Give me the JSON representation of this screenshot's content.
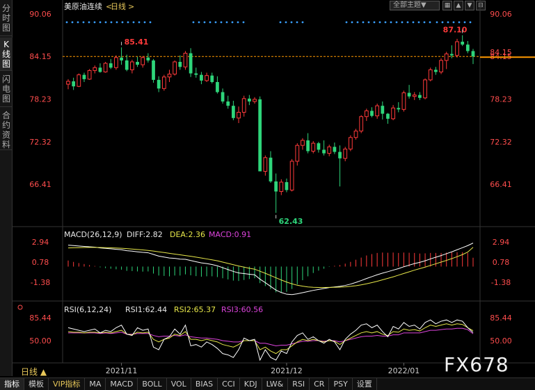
{
  "title": {
    "name": "美原油连续",
    "period": "日线",
    "left_bracket": "<",
    "right_bracket": ">"
  },
  "left_tabs": [
    "分时图",
    "K线图",
    "闪电图",
    "合约资料"
  ],
  "toolbar": {
    "theme": "全部主题▼",
    "btn1": "▦",
    "btn2": "▲",
    "btn3": "▼",
    "btn4": "⊟"
  },
  "price_panel": {
    "y_ticks": [
      "90.06",
      "84.15",
      "78.23",
      "72.32",
      "66.41"
    ],
    "current_price_label": "84.15",
    "marks": {
      "high1": "85.41",
      "low": "62.43",
      "high2": "87.10"
    }
  },
  "macd_panel": {
    "label": "MACD(26,12,9)",
    "diff": "DIFF:2.82",
    "dea": "DEA:2.36",
    "macd": "MACD:0.91",
    "y_ticks": [
      "2.94",
      "0.78",
      "-1.38"
    ]
  },
  "rsi_panel": {
    "label": "RSI(6,12,24)",
    "rsi1": "RSI1:62.44",
    "rsi2": "RSI2:65.37",
    "rsi3": "RSI3:60.56",
    "y_ticks": [
      "85.44",
      "50.00"
    ]
  },
  "x_axis": [
    "2021/11",
    "2021/12",
    "2022/01"
  ],
  "period_selector": "日线 ▲",
  "bottom_tabs": [
    "指标",
    "模板",
    "VIP指标",
    "MA",
    "MACD",
    "BOLL",
    "VOL",
    "BIAS",
    "CCI",
    "KDJ",
    "LW&",
    "RSI",
    "CR",
    "PSY",
    "设置"
  ],
  "brand": "FX678",
  "colors": {
    "up": "#ff3a3a",
    "down": "#2ed57a",
    "diff": "#ffffff",
    "dea": "#e8e84a",
    "rsi1": "#ffffff",
    "rsi2": "#e8e84a",
    "rsi3": "#dd44dd",
    "axis_text": "#ff4d4d",
    "accent": "#e8c85a"
  },
  "chart_data": {
    "type": "candlestick",
    "ylim": [
      62.43,
      90.06
    ],
    "candles": [
      [
        80.3,
        81.0,
        79.6,
        80.7
      ],
      [
        80.7,
        81.2,
        79.5,
        80.0
      ],
      [
        80.0,
        81.8,
        79.9,
        81.6
      ],
      [
        81.6,
        81.9,
        80.6,
        81.0
      ],
      [
        81.0,
        82.4,
        80.9,
        82.2
      ],
      [
        82.2,
        82.9,
        81.8,
        82.6
      ],
      [
        82.6,
        83.2,
        81.9,
        82.0
      ],
      [
        82.0,
        83.4,
        81.9,
        83.2
      ],
      [
        83.2,
        83.8,
        82.4,
        82.6
      ],
      [
        82.6,
        84.3,
        82.3,
        84.0
      ],
      [
        84.0,
        85.41,
        83.0,
        83.6
      ],
      [
        83.6,
        84.4,
        82.1,
        82.3
      ],
      [
        82.3,
        83.7,
        81.8,
        83.4
      ],
      [
        83.4,
        84.1,
        82.7,
        83.0
      ],
      [
        83.0,
        84.2,
        82.6,
        84.0
      ],
      [
        84.0,
        84.6,
        83.3,
        83.6
      ],
      [
        83.6,
        83.8,
        80.5,
        80.9
      ],
      [
        80.9,
        81.4,
        79.2,
        79.7
      ],
      [
        79.7,
        81.6,
        79.4,
        81.3
      ],
      [
        81.3,
        82.3,
        80.6,
        81.7
      ],
      [
        81.7,
        83.6,
        81.5,
        83.4
      ],
      [
        83.4,
        84.3,
        82.3,
        82.7
      ],
      [
        82.7,
        84.9,
        82.3,
        84.6
      ],
      [
        84.6,
        85.3,
        81.3,
        81.8
      ],
      [
        81.8,
        82.6,
        81.2,
        81.6
      ],
      [
        81.6,
        82.0,
        80.3,
        80.8
      ],
      [
        80.8,
        81.9,
        80.6,
        81.5
      ],
      [
        81.5,
        81.9,
        80.4,
        80.6
      ],
      [
        80.6,
        81.4,
        79.0,
        79.2
      ],
      [
        79.2,
        79.7,
        77.6,
        77.9
      ],
      [
        77.9,
        78.7,
        76.9,
        77.3
      ],
      [
        77.3,
        78.0,
        75.3,
        75.6
      ],
      [
        75.6,
        77.2,
        74.9,
        76.4
      ],
      [
        76.4,
        78.7,
        75.8,
        78.3
      ],
      [
        78.3,
        78.8,
        77.4,
        77.9
      ],
      [
        77.9,
        78.5,
        77.6,
        78.2
      ],
      [
        78.2,
        78.6,
        69.0,
        68.2
      ],
      [
        68.2,
        70.4,
        67.6,
        70.1
      ],
      [
        70.1,
        71.0,
        66.6,
        66.8
      ],
      [
        66.8,
        67.9,
        62.43,
        65.4
      ],
      [
        65.4,
        67.1,
        64.9,
        66.7
      ],
      [
        66.7,
        67.2,
        65.3,
        65.6
      ],
      [
        65.6,
        69.9,
        65.4,
        69.6
      ],
      [
        69.6,
        72.1,
        69.0,
        71.8
      ],
      [
        71.8,
        72.8,
        71.2,
        72.5
      ],
      [
        72.5,
        73.5,
        70.7,
        71.0
      ],
      [
        71.0,
        72.4,
        70.7,
        72.1
      ],
      [
        72.1,
        72.3,
        70.8,
        71.2
      ],
      [
        71.2,
        72.5,
        70.4,
        70.7
      ],
      [
        70.7,
        71.9,
        70.3,
        71.6
      ],
      [
        71.6,
        72.2,
        70.6,
        70.9
      ],
      [
        70.9,
        71.8,
        66.1,
        70.0
      ],
      [
        70.0,
        71.6,
        69.6,
        71.3
      ],
      [
        71.3,
        73.2,
        71.0,
        72.9
      ],
      [
        72.9,
        74.1,
        72.6,
        73.8
      ],
      [
        73.8,
        76.0,
        73.5,
        75.8
      ],
      [
        75.8,
        76.9,
        75.2,
        76.6
      ],
      [
        76.6,
        77.1,
        75.7,
        75.9
      ],
      [
        75.9,
        77.6,
        75.5,
        77.3
      ],
      [
        77.3,
        77.9,
        75.4,
        76.2
      ],
      [
        76.2,
        76.3,
        74.8,
        75.5
      ],
      [
        75.5,
        77.4,
        75.3,
        77.0
      ],
      [
        77.0,
        77.8,
        76.4,
        76.8
      ],
      [
        76.8,
        79.4,
        76.5,
        79.1
      ],
      [
        79.1,
        80.2,
        78.3,
        78.6
      ],
      [
        78.6,
        79.2,
        78.1,
        78.8
      ],
      [
        78.8,
        79.2,
        78.1,
        78.4
      ],
      [
        78.4,
        81.1,
        78.2,
        80.9
      ],
      [
        80.9,
        82.6,
        80.7,
        82.3
      ],
      [
        82.3,
        82.7,
        81.6,
        82.0
      ],
      [
        82.0,
        83.9,
        81.7,
        83.6
      ],
      [
        83.6,
        84.8,
        82.4,
        84.5
      ],
      [
        84.5,
        85.7,
        83.9,
        84.3
      ],
      [
        84.3,
        86.6,
        84.0,
        86.2
      ],
      [
        86.2,
        87.1,
        85.6,
        85.8
      ],
      [
        85.8,
        86.3,
        84.6,
        84.9
      ],
      [
        84.9,
        85.2,
        83.1,
        84.15
      ]
    ],
    "dates": {
      "2021/11": 10,
      "2021/12": 41,
      "2022/01": 63
    },
    "macd": {
      "ylim": [
        -3.3,
        3.6
      ],
      "diff": [
        2.6,
        2.55,
        2.5,
        2.46,
        2.42,
        2.38,
        2.3,
        2.25,
        2.2,
        2.15,
        2.1,
        2.0,
        1.95,
        1.88,
        1.82,
        1.78,
        1.6,
        1.42,
        1.32,
        1.22,
        1.18,
        1.1,
        1.08,
        0.95,
        0.82,
        0.7,
        0.62,
        0.52,
        0.38,
        0.18,
        -0.02,
        -0.22,
        -0.38,
        -0.45,
        -0.52,
        -0.58,
        -1.05,
        -1.42,
        -1.82,
        -2.22,
        -2.48,
        -2.66,
        -2.7,
        -2.62,
        -2.5,
        -2.38,
        -2.25,
        -2.15,
        -2.05,
        -1.95,
        -1.88,
        -1.82,
        -1.72,
        -1.58,
        -1.4,
        -1.2,
        -0.98,
        -0.78,
        -0.58,
        -0.4,
        -0.25,
        -0.08,
        0.08,
        0.28,
        0.45,
        0.62,
        0.75,
        0.92,
        1.12,
        1.3,
        1.48,
        1.68,
        1.88,
        2.1,
        2.32,
        2.55,
        2.82
      ],
      "dea": [
        2.3,
        2.32,
        2.33,
        2.34,
        2.35,
        2.35,
        2.34,
        2.33,
        2.31,
        2.29,
        2.26,
        2.22,
        2.18,
        2.13,
        2.08,
        2.03,
        1.96,
        1.88,
        1.8,
        1.72,
        1.64,
        1.56,
        1.48,
        1.4,
        1.31,
        1.22,
        1.12,
        1.02,
        0.92,
        0.78,
        0.64,
        0.5,
        0.36,
        0.24,
        0.12,
        0.02,
        -0.2,
        -0.42,
        -0.66,
        -0.9,
        -1.14,
        -1.36,
        -1.55,
        -1.7,
        -1.8,
        -1.88,
        -1.92,
        -1.94,
        -1.94,
        -1.93,
        -1.92,
        -1.9,
        -1.87,
        -1.82,
        -1.75,
        -1.66,
        -1.55,
        -1.42,
        -1.28,
        -1.12,
        -0.96,
        -0.8,
        -0.62,
        -0.44,
        -0.26,
        -0.08,
        0.08,
        0.24,
        0.42,
        0.6,
        0.78,
        0.96,
        1.15,
        1.36,
        1.58,
        1.85,
        2.36
      ],
      "hist": [
        0.62,
        0.48,
        0.36,
        0.26,
        0.16,
        0.06,
        -0.08,
        -0.16,
        -0.22,
        -0.28,
        -0.32,
        -0.44,
        -0.46,
        -0.5,
        -0.52,
        -0.5,
        -0.72,
        -0.92,
        -0.96,
        -1.0,
        -0.92,
        -0.92,
        -0.8,
        -0.9,
        -0.98,
        -1.04,
        -1.0,
        -1.0,
        -1.08,
        -1.2,
        -1.32,
        -1.44,
        -1.48,
        -1.38,
        -1.28,
        -1.2,
        -1.7,
        -2.0,
        -2.32,
        -2.64,
        -2.68,
        -2.6,
        -2.3,
        -1.84,
        -1.4,
        -1.0,
        -0.66,
        -0.42,
        -0.22,
        -0.04,
        0.08,
        0.16,
        0.3,
        0.48,
        0.7,
        0.92,
        1.14,
        1.28,
        1.4,
        1.44,
        1.42,
        1.44,
        1.4,
        1.44,
        1.42,
        1.4,
        1.34,
        1.36,
        1.4,
        1.4,
        1.4,
        1.44,
        1.46,
        1.48,
        1.48,
        1.4,
        0.91
      ]
    },
    "rsi": {
      "ylim": [
        10,
        100
      ],
      "rsi1": [
        70,
        68,
        66,
        64,
        66,
        68,
        62,
        66,
        64,
        70,
        74,
        60,
        58,
        70,
        66,
        68,
        40,
        36,
        52,
        56,
        68,
        60,
        74,
        42,
        44,
        40,
        48,
        44,
        38,
        30,
        28,
        24,
        36,
        54,
        50,
        52,
        20,
        36,
        24,
        18,
        34,
        30,
        48,
        58,
        62,
        52,
        56,
        50,
        46,
        52,
        48,
        36,
        52,
        60,
        66,
        74,
        76,
        70,
        74,
        64,
        56,
        72,
        68,
        78,
        72,
        74,
        68,
        78,
        82,
        76,
        80,
        82,
        78,
        82,
        80,
        70,
        62.44
      ],
      "rsi2": [
        64,
        63,
        63,
        62,
        63,
        63,
        62,
        63,
        62,
        64,
        66,
        60,
        59,
        63,
        62,
        63,
        52,
        48,
        52,
        54,
        60,
        58,
        64,
        52,
        52,
        50,
        52,
        50,
        48,
        44,
        42,
        40,
        44,
        50,
        50,
        50,
        36,
        40,
        34,
        30,
        36,
        36,
        42,
        48,
        52,
        50,
        52,
        50,
        48,
        50,
        49,
        44,
        50,
        54,
        58,
        62,
        64,
        62,
        64,
        60,
        58,
        64,
        63,
        68,
        66,
        67,
        65,
        70,
        74,
        72,
        74,
        76,
        74,
        76,
        75,
        70,
        65.37
      ],
      "rsi3": [
        62,
        62,
        62,
        62,
        62,
        62,
        61,
        62,
        61,
        62,
        63,
        60,
        60,
        61,
        61,
        61,
        58,
        56,
        57,
        57,
        58,
        57,
        59,
        56,
        55,
        54,
        54,
        53,
        52,
        50,
        49,
        48,
        48,
        50,
        50,
        50,
        46,
        46,
        44,
        42,
        43,
        43,
        45,
        47,
        49,
        49,
        50,
        50,
        49,
        50,
        50,
        48,
        50,
        52,
        54,
        56,
        57,
        57,
        58,
        57,
        57,
        59,
        59,
        62,
        62,
        62,
        62,
        64,
        66,
        66,
        67,
        68,
        68,
        69,
        69,
        67,
        60.56
      ]
    }
  }
}
